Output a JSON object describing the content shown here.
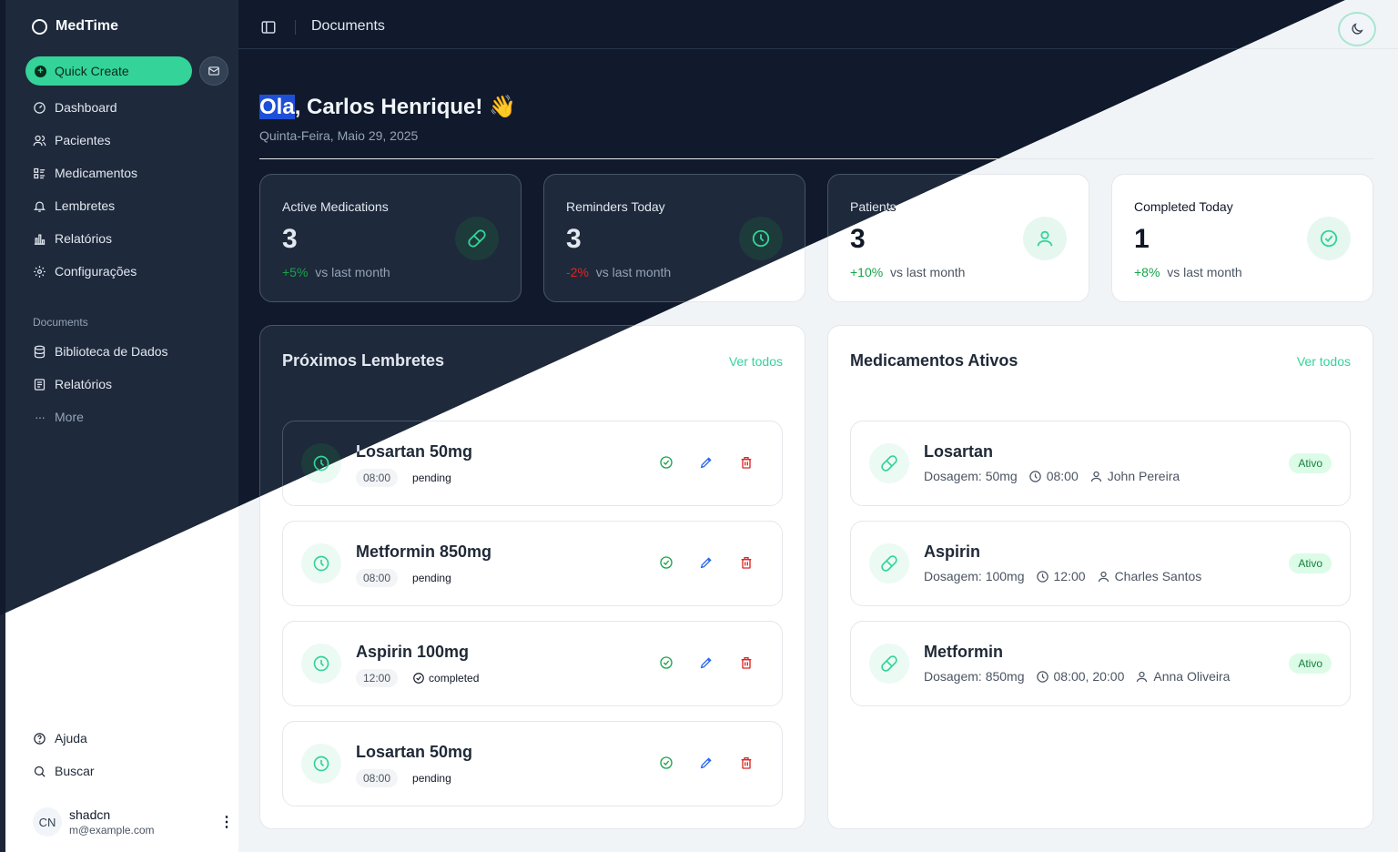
{
  "app": {
    "name": "MedTime"
  },
  "sidebar": {
    "quick_create": "Quick Create",
    "nav": [
      {
        "label": "Dashboard",
        "icon": "dashboard-icon"
      },
      {
        "label": "Pacientes",
        "icon": "users-icon"
      },
      {
        "label": "Medicamentos",
        "icon": "list-icon"
      },
      {
        "label": "Lembretes",
        "icon": "bell-icon"
      },
      {
        "label": "Relatórios",
        "icon": "bar-chart-icon"
      },
      {
        "label": "Configurações",
        "icon": "gear-icon"
      }
    ],
    "documents_heading": "Documents",
    "documents": [
      {
        "label": "Biblioteca de Dados",
        "icon": "database-icon"
      },
      {
        "label": "Relatórios",
        "icon": "report-icon"
      }
    ],
    "more": "More",
    "secondary": [
      {
        "label": "Ajuda",
        "icon": "help-icon"
      },
      {
        "label": "Buscar",
        "icon": "search-icon"
      }
    ],
    "user": {
      "initials": "CN",
      "name": "shadcn",
      "email": "m@example.com"
    }
  },
  "header": {
    "breadcrumb": "Documents"
  },
  "greeting": {
    "highlight": "Ola",
    "rest": ", Carlos Henrique! 👋",
    "date": "Quinta-Feira, Maio 29, 2025"
  },
  "stats": [
    {
      "label": "Active Medications",
      "value": "3",
      "delta": "+5%",
      "direction": "up",
      "vs": "vs last month",
      "icon": "pill-icon"
    },
    {
      "label": "Reminders Today",
      "value": "3",
      "delta": "-2%",
      "direction": "down",
      "vs": "vs last month",
      "icon": "clock-icon"
    },
    {
      "label": "Patients",
      "value": "3",
      "delta": "+10%",
      "direction": "up",
      "vs": "vs last month",
      "icon": "user-icon"
    },
    {
      "label": "Completed Today",
      "value": "1",
      "delta": "+8%",
      "direction": "up",
      "vs": "vs last month",
      "icon": "check-circle-icon"
    }
  ],
  "reminders": {
    "title": "Próximos Lembretes",
    "see_all": "Ver todos",
    "items": [
      {
        "name": "Losartan 50mg",
        "time": "08:00",
        "status": "pending"
      },
      {
        "name": "Metformin 850mg",
        "time": "08:00",
        "status": "pending"
      },
      {
        "name": "Aspirin 100mg",
        "time": "12:00",
        "status": "completed"
      },
      {
        "name": "Losartan 50mg",
        "time": "08:00",
        "status": "pending"
      }
    ]
  },
  "medications": {
    "title": "Medicamentos Ativos",
    "see_all": "Ver todos",
    "items": [
      {
        "name": "Losartan",
        "dosage": "Dosagem: 50mg",
        "times": "08:00",
        "patient": "John Pereira",
        "badge": "Ativo"
      },
      {
        "name": "Aspirin",
        "dosage": "Dosagem: 100mg",
        "times": "12:00",
        "patient": "Charles Santos",
        "badge": "Ativo"
      },
      {
        "name": "Metformin",
        "dosage": "Dosagem: 850mg",
        "times": "08:00, 20:00",
        "patient": "Anna Oliveira",
        "badge": "Ativo"
      }
    ]
  },
  "colors": {
    "accent": "#34d399",
    "dark_bg": "#111a2c",
    "dark_card": "#1e293b",
    "light_bg": "#f1f4f6"
  }
}
